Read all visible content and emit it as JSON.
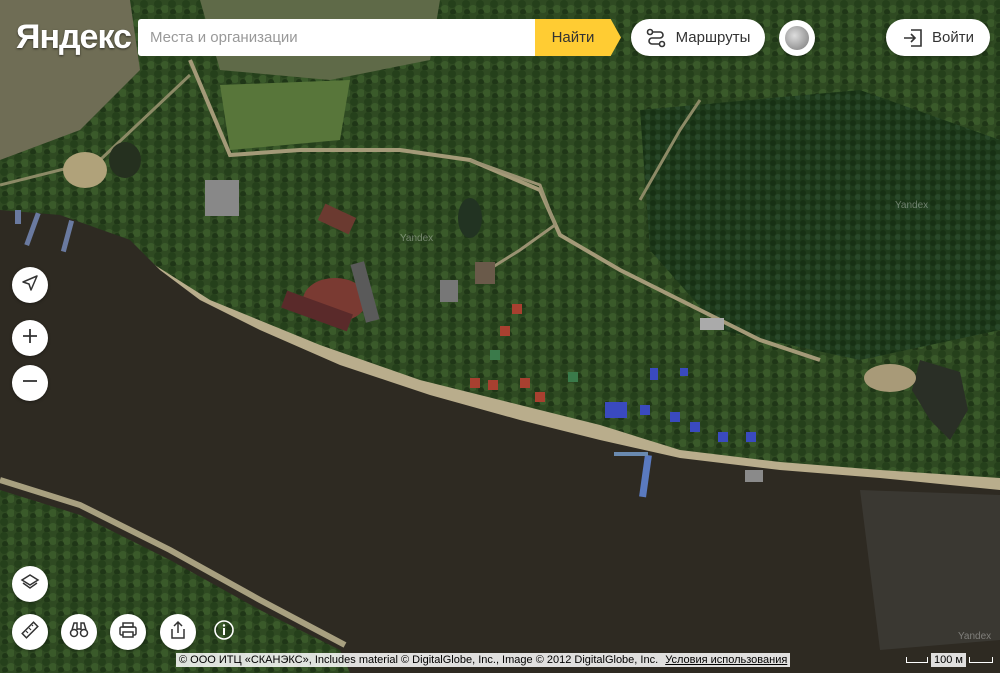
{
  "header": {
    "logo": "Яндекс",
    "search_placeholder": "Места и организации",
    "search_value": "",
    "search_button": "Найти",
    "routes_button": "Маршруты",
    "login_button": "Войти"
  },
  "map": {
    "watermarks": [
      "Yandex",
      "Yandex",
      "Yandex"
    ],
    "copyright": "© ООО ИТЦ «СКАНЭКС», Includes material © DigitalGlobe, Inc., Image © 2012 DigitalGlobe, Inc.",
    "terms_link": "Условия использования",
    "scale_label": "100 м"
  },
  "icons": {
    "routes": "routes-icon",
    "login": "login-icon",
    "locate": "location-arrow-icon",
    "zoom_in": "plus-icon",
    "zoom_out": "minus-icon",
    "layers": "layers-icon",
    "ruler": "ruler-icon",
    "panorama": "binoculars-icon",
    "print": "printer-icon",
    "share": "share-icon",
    "info": "info-icon"
  }
}
